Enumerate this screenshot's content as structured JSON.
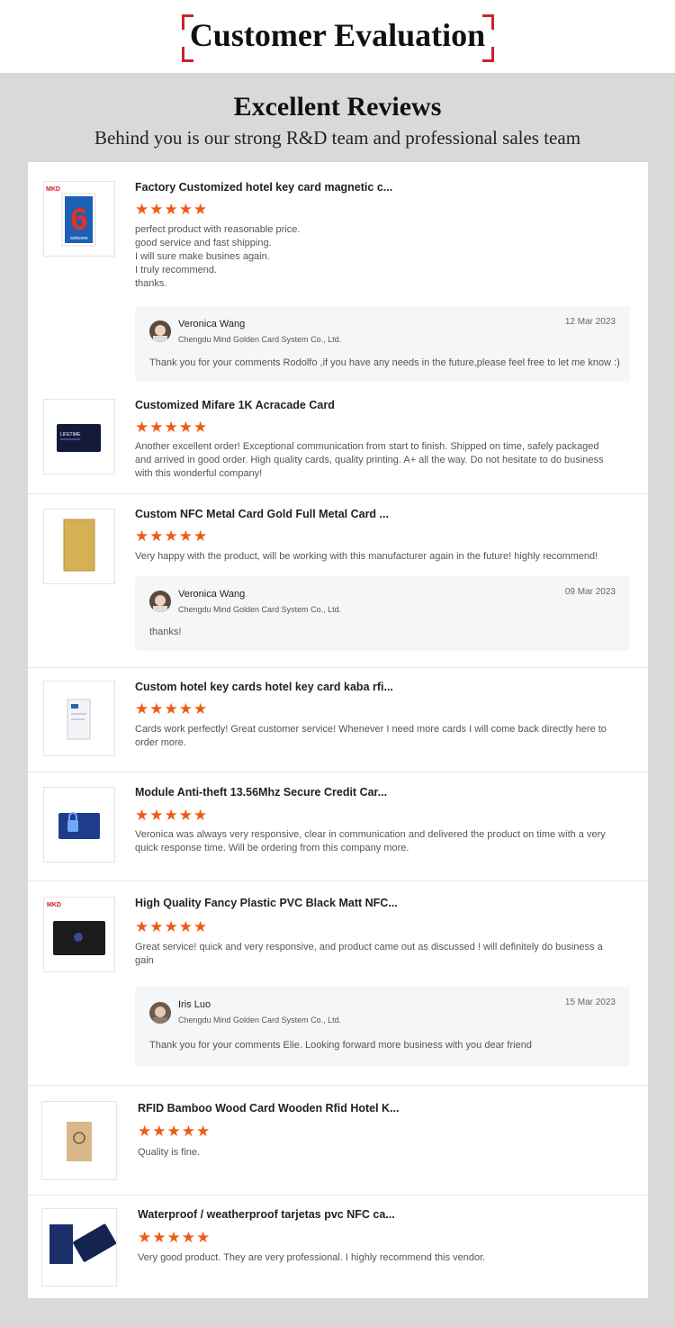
{
  "header": {
    "title": "Customer Evaluation"
  },
  "intro": {
    "heading": "Excellent Reviews",
    "subheading": "Behind you is our strong R&D team and professional sales team"
  },
  "stars": "★★★★★",
  "colors": {
    "accent": "#c8242d",
    "star": "#f05a14"
  },
  "reviews": [
    {
      "title": "Factory Customized hotel key card magnetic c...",
      "text": "perfect product with reasonable price.\ngood service and fast shipping.\nI will sure make busines again.\nI truly recommend.\nthanks.",
      "image_badge": "MKD",
      "image_number": "6",
      "image_word": "welcome",
      "reply": {
        "name": "Veronica Wang",
        "company": "Chengdu Mind Golden Card System Co., Ltd.",
        "date": "12 Mar 2023",
        "text": "Thank you for your comments Rodolfo ,if you have any needs in the future,please feel free to let me know :)"
      }
    },
    {
      "title": "Customized Mifare 1K Acracade Card",
      "text": "Another excellent order! Exceptional communication from start to finish. Shipped on time, safely packaged and arrived in good order. High quality cards, quality printing. A+ all the way. Do not hesitate to do business with this wonderful company!",
      "image_word": "LIFETIME"
    },
    {
      "title": "Custom NFC Metal Card Gold Full Metal Card ...",
      "text": "Very happy with the product, will be working with this manufacturer again in the future! highly recommend!",
      "reply": {
        "name": "Veronica Wang",
        "company": "Chengdu Mind Golden Card System Co., Ltd.",
        "date": "09 Mar 2023",
        "text": "thanks!"
      }
    },
    {
      "title": "Custom hotel key cards hotel key card kaba rfi...",
      "text": "Cards work perfectly! Great customer service! Whenever I need more cards I will come back directly here to order more."
    },
    {
      "title": "Module Anti-theft 13.56Mhz Secure Credit Car...",
      "text": "Veronica was always very responsive, clear in communication and delivered the product on time with a very quick response time. Will be ordering from this company more."
    },
    {
      "title": "High Quality Fancy Plastic PVC Black Matt NFC...",
      "text": "Great service! quick and very responsive, and product came out as discussed ! will definitely do business a gain",
      "image_badge": "MKD",
      "reply": {
        "name": "Iris Luo",
        "company": "Chengdu Mind Golden Card System Co., Ltd.",
        "date": "15 Mar 2023",
        "text": "Thank you for your comments Elie. Looking forward more business with you dear friend"
      }
    },
    {
      "title": "RFID Bamboo Wood Card Wooden Rfid Hotel K...",
      "text": "Quality is fine."
    },
    {
      "title": "Waterproof / weatherproof tarjetas pvc NFC ca...",
      "text": "Very good product.  They are very professional.  I highly recommend this vendor."
    }
  ]
}
